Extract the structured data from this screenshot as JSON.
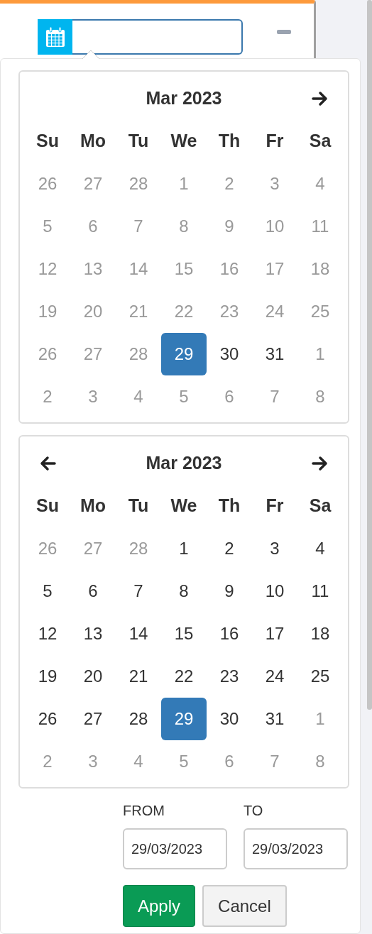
{
  "calendars": [
    {
      "title": "Mar 2023",
      "prev_arrow": false,
      "next_arrow": true,
      "weekdays": [
        "Su",
        "Mo",
        "Tu",
        "We",
        "Th",
        "Fr",
        "Sa"
      ],
      "weeks": [
        [
          {
            "day": "26",
            "muted": true,
            "selected": false
          },
          {
            "day": "27",
            "muted": true,
            "selected": false
          },
          {
            "day": "28",
            "muted": true,
            "selected": false
          },
          {
            "day": "1",
            "muted": true,
            "selected": false
          },
          {
            "day": "2",
            "muted": true,
            "selected": false
          },
          {
            "day": "3",
            "muted": true,
            "selected": false
          },
          {
            "day": "4",
            "muted": true,
            "selected": false
          }
        ],
        [
          {
            "day": "5",
            "muted": true,
            "selected": false
          },
          {
            "day": "6",
            "muted": true,
            "selected": false
          },
          {
            "day": "7",
            "muted": true,
            "selected": false
          },
          {
            "day": "8",
            "muted": true,
            "selected": false
          },
          {
            "day": "9",
            "muted": true,
            "selected": false
          },
          {
            "day": "10",
            "muted": true,
            "selected": false
          },
          {
            "day": "11",
            "muted": true,
            "selected": false
          }
        ],
        [
          {
            "day": "12",
            "muted": true,
            "selected": false
          },
          {
            "day": "13",
            "muted": true,
            "selected": false
          },
          {
            "day": "14",
            "muted": true,
            "selected": false
          },
          {
            "day": "15",
            "muted": true,
            "selected": false
          },
          {
            "day": "16",
            "muted": true,
            "selected": false
          },
          {
            "day": "17",
            "muted": true,
            "selected": false
          },
          {
            "day": "18",
            "muted": true,
            "selected": false
          }
        ],
        [
          {
            "day": "19",
            "muted": true,
            "selected": false
          },
          {
            "day": "20",
            "muted": true,
            "selected": false
          },
          {
            "day": "21",
            "muted": true,
            "selected": false
          },
          {
            "day": "22",
            "muted": true,
            "selected": false
          },
          {
            "day": "23",
            "muted": true,
            "selected": false
          },
          {
            "day": "24",
            "muted": true,
            "selected": false
          },
          {
            "day": "25",
            "muted": true,
            "selected": false
          }
        ],
        [
          {
            "day": "26",
            "muted": true,
            "selected": false
          },
          {
            "day": "27",
            "muted": true,
            "selected": false
          },
          {
            "day": "28",
            "muted": true,
            "selected": false
          },
          {
            "day": "29",
            "muted": false,
            "selected": true
          },
          {
            "day": "30",
            "muted": false,
            "selected": false
          },
          {
            "day": "31",
            "muted": false,
            "selected": false
          },
          {
            "day": "1",
            "muted": true,
            "selected": false
          }
        ],
        [
          {
            "day": "2",
            "muted": true,
            "selected": false
          },
          {
            "day": "3",
            "muted": true,
            "selected": false
          },
          {
            "day": "4",
            "muted": true,
            "selected": false
          },
          {
            "day": "5",
            "muted": true,
            "selected": false
          },
          {
            "day": "6",
            "muted": true,
            "selected": false
          },
          {
            "day": "7",
            "muted": true,
            "selected": false
          },
          {
            "day": "8",
            "muted": true,
            "selected": false
          }
        ]
      ]
    },
    {
      "title": "Mar 2023",
      "prev_arrow": true,
      "next_arrow": true,
      "weekdays": [
        "Su",
        "Mo",
        "Tu",
        "We",
        "Th",
        "Fr",
        "Sa"
      ],
      "weeks": [
        [
          {
            "day": "26",
            "muted": true,
            "selected": false
          },
          {
            "day": "27",
            "muted": true,
            "selected": false
          },
          {
            "day": "28",
            "muted": true,
            "selected": false
          },
          {
            "day": "1",
            "muted": false,
            "selected": false
          },
          {
            "day": "2",
            "muted": false,
            "selected": false
          },
          {
            "day": "3",
            "muted": false,
            "selected": false
          },
          {
            "day": "4",
            "muted": false,
            "selected": false
          }
        ],
        [
          {
            "day": "5",
            "muted": false,
            "selected": false
          },
          {
            "day": "6",
            "muted": false,
            "selected": false
          },
          {
            "day": "7",
            "muted": false,
            "selected": false
          },
          {
            "day": "8",
            "muted": false,
            "selected": false
          },
          {
            "day": "9",
            "muted": false,
            "selected": false
          },
          {
            "day": "10",
            "muted": false,
            "selected": false
          },
          {
            "day": "11",
            "muted": false,
            "selected": false
          }
        ],
        [
          {
            "day": "12",
            "muted": false,
            "selected": false
          },
          {
            "day": "13",
            "muted": false,
            "selected": false
          },
          {
            "day": "14",
            "muted": false,
            "selected": false
          },
          {
            "day": "15",
            "muted": false,
            "selected": false
          },
          {
            "day": "16",
            "muted": false,
            "selected": false
          },
          {
            "day": "17",
            "muted": false,
            "selected": false
          },
          {
            "day": "18",
            "muted": false,
            "selected": false
          }
        ],
        [
          {
            "day": "19",
            "muted": false,
            "selected": false
          },
          {
            "day": "20",
            "muted": false,
            "selected": false
          },
          {
            "day": "21",
            "muted": false,
            "selected": false
          },
          {
            "day": "22",
            "muted": false,
            "selected": false
          },
          {
            "day": "23",
            "muted": false,
            "selected": false
          },
          {
            "day": "24",
            "muted": false,
            "selected": false
          },
          {
            "day": "25",
            "muted": false,
            "selected": false
          }
        ],
        [
          {
            "day": "26",
            "muted": false,
            "selected": false
          },
          {
            "day": "27",
            "muted": false,
            "selected": false
          },
          {
            "day": "28",
            "muted": false,
            "selected": false
          },
          {
            "day": "29",
            "muted": false,
            "selected": true
          },
          {
            "day": "30",
            "muted": false,
            "selected": false
          },
          {
            "day": "31",
            "muted": false,
            "selected": false
          },
          {
            "day": "1",
            "muted": true,
            "selected": false
          }
        ],
        [
          {
            "day": "2",
            "muted": true,
            "selected": false
          },
          {
            "day": "3",
            "muted": true,
            "selected": false
          },
          {
            "day": "4",
            "muted": true,
            "selected": false
          },
          {
            "day": "5",
            "muted": true,
            "selected": false
          },
          {
            "day": "6",
            "muted": true,
            "selected": false
          },
          {
            "day": "7",
            "muted": true,
            "selected": false
          },
          {
            "day": "8",
            "muted": true,
            "selected": false
          }
        ]
      ]
    }
  ],
  "range": {
    "from_label": "FROM",
    "from_value": "29/03/2023",
    "to_label": "TO",
    "to_value": "29/03/2023"
  },
  "buttons": [
    {
      "label": "Apply",
      "kind": "primary"
    },
    {
      "label": "Cancel",
      "kind": "secondary"
    }
  ]
}
